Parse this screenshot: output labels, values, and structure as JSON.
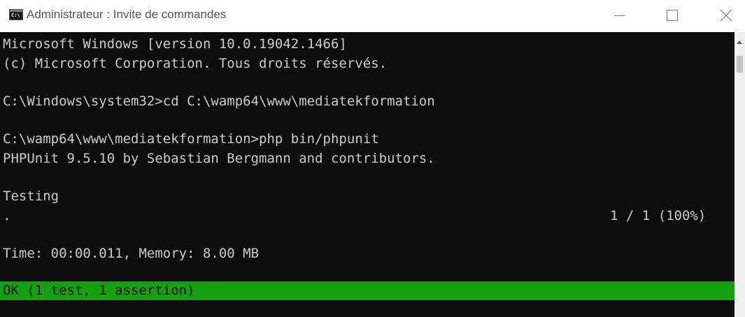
{
  "window": {
    "title": "Administrateur : Invite de commandes",
    "icon": "cmd-icon",
    "controls": [
      "minimize-icon",
      "maximize-icon",
      "close-icon"
    ]
  },
  "console": {
    "lines": [
      "Microsoft Windows [version 10.0.19042.1466]",
      "(c) Microsoft Corporation. Tous droits réservés.",
      "",
      "C:\\Windows\\system32>cd C:\\wamp64\\www\\mediatekformation",
      "",
      "C:\\wamp64\\www\\mediatekformation>php bin/phpunit",
      "PHPUnit 9.5.10 by Sebastian Bergmann and contributors.",
      "",
      "Testing",
      ".",
      "",
      "Time: 00:00.011, Memory: 8.00 MB"
    ],
    "progress": "1 / 1 (100%)",
    "result": "OK (1 test, 1 assertion)",
    "colors": {
      "background": "#0c0c0c",
      "foreground": "#cccccc",
      "ok_background": "#13a10e"
    }
  }
}
